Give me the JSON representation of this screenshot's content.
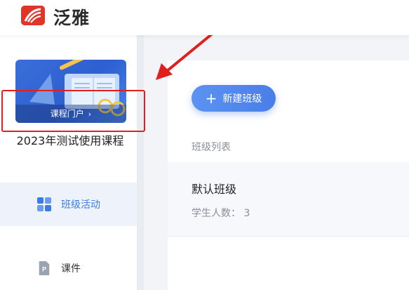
{
  "header": {
    "brand": "泛雅",
    "logo_icon": "chaoxing-logo-icon"
  },
  "sidebar": {
    "cover_caption": "课程门户",
    "cover_chevron": "›",
    "course_title": "2023年测试使用课程",
    "nav": [
      {
        "label": "班级活动",
        "icon": "grid-icon",
        "active": true
      },
      {
        "label": "课件",
        "icon": "ppt-file-icon",
        "active": false
      }
    ]
  },
  "main": {
    "new_button_label": "新建班级",
    "list_label": "班级列表",
    "class": {
      "name": "默认班级",
      "meta": "学生人数： 3"
    }
  },
  "annotation": {
    "color": "#e0201f"
  }
}
